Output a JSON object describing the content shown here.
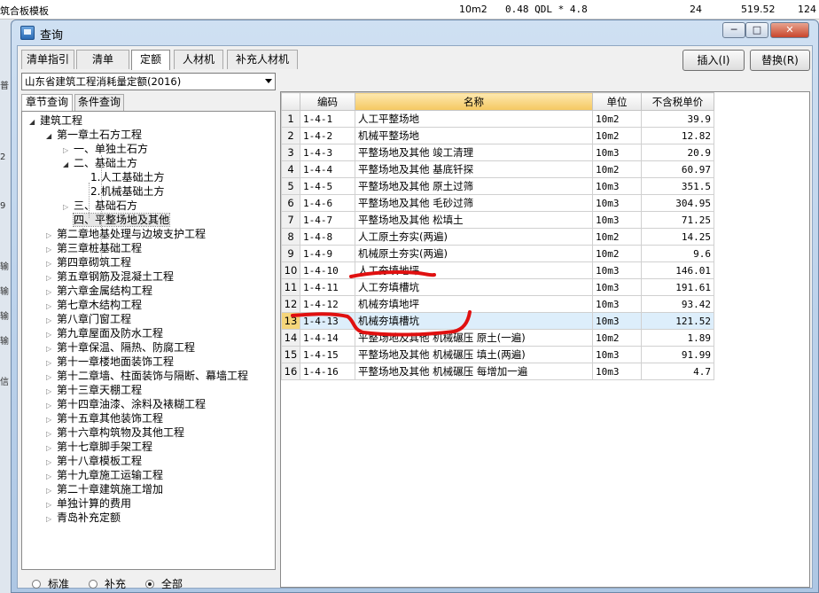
{
  "background": {
    "top_text": "筑合板模板",
    "top_unit": "10m2",
    "top_formula": "0.48 QDL * 4.8",
    "top_val1": "24",
    "top_val2": "519.52",
    "top_val3": "124",
    "left_labels": [
      "普",
      "2",
      "9",
      "输",
      "输",
      "输",
      "输",
      "信"
    ]
  },
  "window": {
    "title": "查询",
    "min_glyph": "─",
    "max_glyph": "□",
    "close_glyph": "✕"
  },
  "tabs": [
    {
      "label": "清单指引"
    },
    {
      "label": "清单"
    },
    {
      "label": "定额"
    },
    {
      "label": "人材机"
    },
    {
      "label": "补充人材机"
    }
  ],
  "buttons": {
    "insert": "插入(I)",
    "replace": "替换(R)"
  },
  "quota_library": "山东省建筑工程消耗量定额(2016)",
  "subtabs": [
    {
      "label": "章节查询"
    },
    {
      "label": "条件查询"
    }
  ],
  "tree": [
    {
      "label": "建筑工程",
      "toggle": "◢"
    },
    {
      "label": "第一章土石方工程",
      "toggle": "◢"
    },
    {
      "label": "一、单独土石方",
      "toggle": "▷"
    },
    {
      "label": "二、基础土方",
      "toggle": "◢"
    },
    {
      "label": "1.人工基础土方",
      "toggle": ""
    },
    {
      "label": "2.机械基础土方",
      "toggle": ""
    },
    {
      "label": "三、基础石方",
      "toggle": "▷"
    },
    {
      "label": "四、平整场地及其他",
      "toggle": ""
    },
    {
      "label": "第二章地基处理与边坡支护工程",
      "toggle": "▷"
    },
    {
      "label": "第三章桩基础工程",
      "toggle": "▷"
    },
    {
      "label": "第四章砌筑工程",
      "toggle": "▷"
    },
    {
      "label": "第五章钢筋及混凝土工程",
      "toggle": "▷"
    },
    {
      "label": "第六章金属结构工程",
      "toggle": "▷"
    },
    {
      "label": "第七章木结构工程",
      "toggle": "▷"
    },
    {
      "label": "第八章门窗工程",
      "toggle": "▷"
    },
    {
      "label": "第九章屋面及防水工程",
      "toggle": "▷"
    },
    {
      "label": "第十章保温、隔热、防腐工程",
      "toggle": "▷"
    },
    {
      "label": "第十一章楼地面装饰工程",
      "toggle": "▷"
    },
    {
      "label": "第十二章墙、柱面装饰与隔断、幕墙工程",
      "toggle": "▷"
    },
    {
      "label": "第十三章天棚工程",
      "toggle": "▷"
    },
    {
      "label": "第十四章油漆、涂料及裱糊工程",
      "toggle": "▷"
    },
    {
      "label": "第十五章其他装饰工程",
      "toggle": "▷"
    },
    {
      "label": "第十六章构筑物及其他工程",
      "toggle": "▷"
    },
    {
      "label": "第十七章脚手架工程",
      "toggle": "▷"
    },
    {
      "label": "第十八章模板工程",
      "toggle": "▷"
    },
    {
      "label": "第十九章施工运输工程",
      "toggle": "▷"
    },
    {
      "label": "第二十章建筑施工增加",
      "toggle": "▷"
    },
    {
      "label": "单独计算的费用",
      "toggle": "▷"
    },
    {
      "label": "青岛补充定额",
      "toggle": "▷"
    }
  ],
  "filters": [
    {
      "label": "标准",
      "checked": false
    },
    {
      "label": "补充",
      "checked": false
    },
    {
      "label": "全部",
      "checked": true
    }
  ],
  "grid": {
    "columns": [
      "",
      "编码",
      "名称",
      "单位",
      "不含税单价"
    ],
    "rows": [
      {
        "n": "1",
        "code": "1-4-1",
        "name": "人工平整场地",
        "unit": "10m2",
        "price": "39.9"
      },
      {
        "n": "2",
        "code": "1-4-2",
        "name": "机械平整场地",
        "unit": "10m2",
        "price": "12.82"
      },
      {
        "n": "3",
        "code": "1-4-3",
        "name": "平整场地及其他 竣工清理",
        "unit": "10m3",
        "price": "20.9"
      },
      {
        "n": "4",
        "code": "1-4-4",
        "name": "平整场地及其他 基底钎探",
        "unit": "10m2",
        "price": "60.97"
      },
      {
        "n": "5",
        "code": "1-4-5",
        "name": "平整场地及其他 原土过筛",
        "unit": "10m3",
        "price": "351.5"
      },
      {
        "n": "6",
        "code": "1-4-6",
        "name": "平整场地及其他 毛砂过筛",
        "unit": "10m3",
        "price": "304.95"
      },
      {
        "n": "7",
        "code": "1-4-7",
        "name": "平整场地及其他 松填土",
        "unit": "10m3",
        "price": "71.25"
      },
      {
        "n": "8",
        "code": "1-4-8",
        "name": "人工原土夯实(两遍)",
        "unit": "10m2",
        "price": "14.25"
      },
      {
        "n": "9",
        "code": "1-4-9",
        "name": "机械原土夯实(两遍)",
        "unit": "10m2",
        "price": "9.6"
      },
      {
        "n": "10",
        "code": "1-4-10",
        "name": "人工夯填地坪",
        "unit": "10m3",
        "price": "146.01"
      },
      {
        "n": "11",
        "code": "1-4-11",
        "name": "人工夯填槽坑",
        "unit": "10m3",
        "price": "191.61"
      },
      {
        "n": "12",
        "code": "1-4-12",
        "name": "机械夯填地坪",
        "unit": "10m3",
        "price": "93.42"
      },
      {
        "n": "13",
        "code": "1-4-13",
        "name": "机械夯填槽坑",
        "unit": "10m3",
        "price": "121.52"
      },
      {
        "n": "14",
        "code": "1-4-14",
        "name": "平整场地及其他 机械碾压 原土(一遍)",
        "unit": "10m2",
        "price": "1.89"
      },
      {
        "n": "15",
        "code": "1-4-15",
        "name": "平整场地及其他 机械碾压 填土(两遍)",
        "unit": "10m3",
        "price": "91.99"
      },
      {
        "n": "16",
        "code": "1-4-16",
        "name": "平整场地及其他 机械碾压 每增加一遍",
        "unit": "10m3",
        "price": "4.7"
      }
    ],
    "selected_row": "13"
  },
  "colors": {
    "annotation": "#e01010",
    "selected_row_bg": "#ddeefb",
    "header_highlight": "#f5c860"
  }
}
